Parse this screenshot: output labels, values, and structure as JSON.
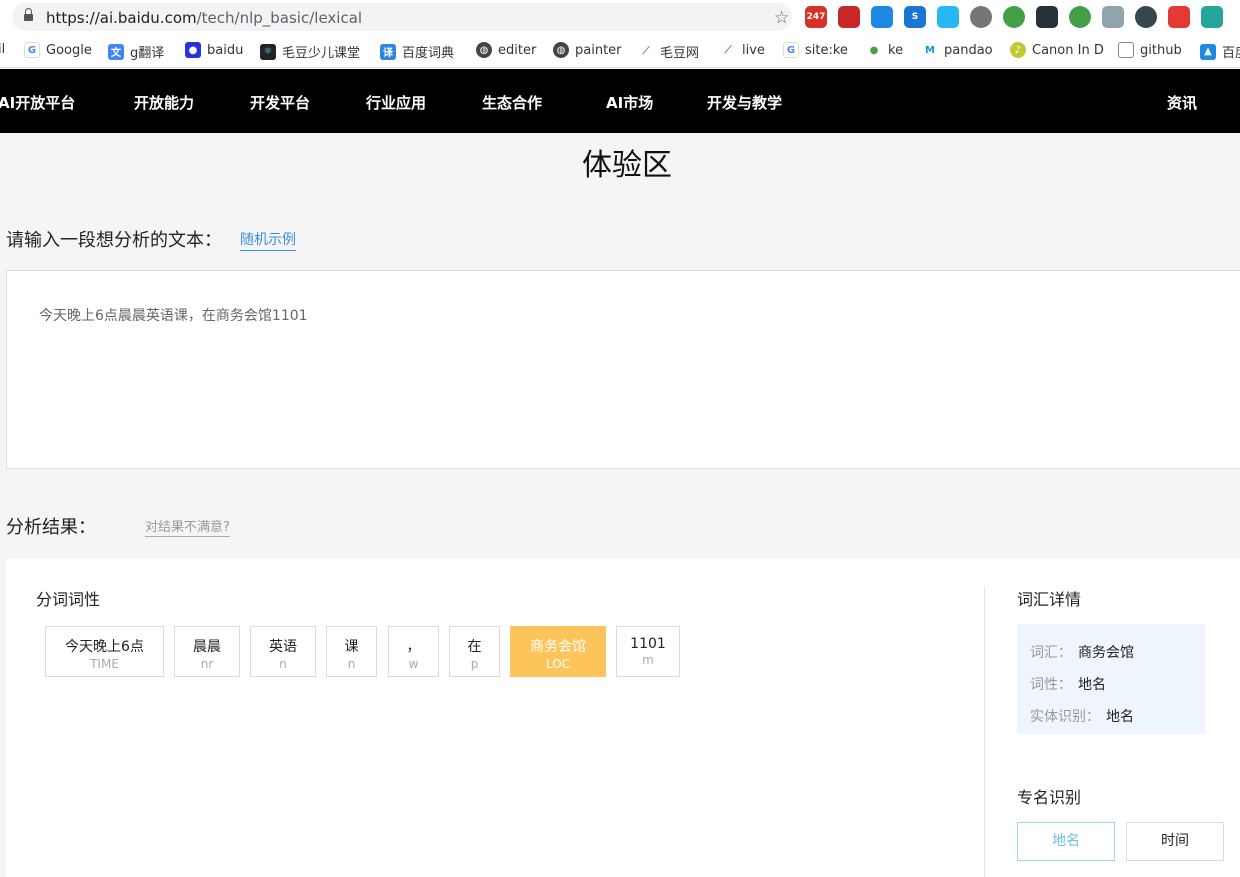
{
  "browser": {
    "url_host": "https://ai.baidu.com",
    "url_path": "/tech/nlp_basic/lexical",
    "bookmarks": [
      {
        "label": "il",
        "icon": "none"
      },
      {
        "label": "Google",
        "icon": "google-icon"
      },
      {
        "label": "g翻译",
        "icon": "translate-icon"
      },
      {
        "label": "baidu",
        "icon": "baidu-paw-icon"
      },
      {
        "label": "毛豆少儿课堂",
        "icon": "react-icon"
      },
      {
        "label": "百度词典",
        "icon": "dictionary-icon"
      },
      {
        "label": "editer",
        "icon": "globe-icon"
      },
      {
        "label": "painter",
        "icon": "globe-icon"
      },
      {
        "label": "毛豆网",
        "icon": "leaf-icon"
      },
      {
        "label": "live",
        "icon": "leaf-icon"
      },
      {
        "label": "site:ke",
        "icon": "google-icon"
      },
      {
        "label": "ke",
        "icon": "bean-icon"
      },
      {
        "label": "pandao",
        "icon": "m-logo-icon"
      },
      {
        "label": "Canon In D",
        "icon": "music-icon"
      },
      {
        "label": "github",
        "icon": "folder-icon"
      },
      {
        "label": "百度",
        "icon": "chart-icon"
      }
    ],
    "extension_badge": "247"
  },
  "nav": {
    "brand": "AI开放平台",
    "items": [
      "开放能力",
      "开发平台",
      "行业应用",
      "生态合作",
      "AI市场",
      "开发与教学"
    ],
    "right": "资讯"
  },
  "main": {
    "section_title": "体验区",
    "prompt": "请输入一段想分析的文本：",
    "random_link": "随机示例",
    "input_text": "今天晚上6点晨晨英语课，在商务会馆1101",
    "result_title": "分析结果：",
    "unhappy_link": "对结果不满意?",
    "seg_title": "分词词性",
    "tokens": [
      {
        "word": "今天晚上6点",
        "pos": "TIME",
        "active": false
      },
      {
        "word": "晨晨",
        "pos": "nr",
        "active": false
      },
      {
        "word": "英语",
        "pos": "n",
        "active": false
      },
      {
        "word": "课",
        "pos": "n",
        "active": false
      },
      {
        "word": "，",
        "pos": "w",
        "active": false
      },
      {
        "word": "在",
        "pos": "p",
        "active": false
      },
      {
        "word": "商务会馆",
        "pos": "LOC",
        "active": true
      },
      {
        "word": "1101",
        "pos": "m",
        "active": false
      }
    ],
    "detail": {
      "title": "词汇详情",
      "rows": [
        {
          "key": "词汇：",
          "value": "商务会馆"
        },
        {
          "key": "词性：",
          "value": "地名"
        },
        {
          "key": "实体识别：",
          "value": "地名"
        }
      ]
    },
    "ner": {
      "title": "专名识别",
      "buttons": [
        {
          "label": "地名",
          "selected": true
        },
        {
          "label": "时间",
          "selected": false
        }
      ]
    }
  },
  "colors": {
    "active_token": "#fdc45c",
    "link": "#3a8ee6",
    "detail_bg": "#eef5fd",
    "nav_bg": "#000000"
  }
}
